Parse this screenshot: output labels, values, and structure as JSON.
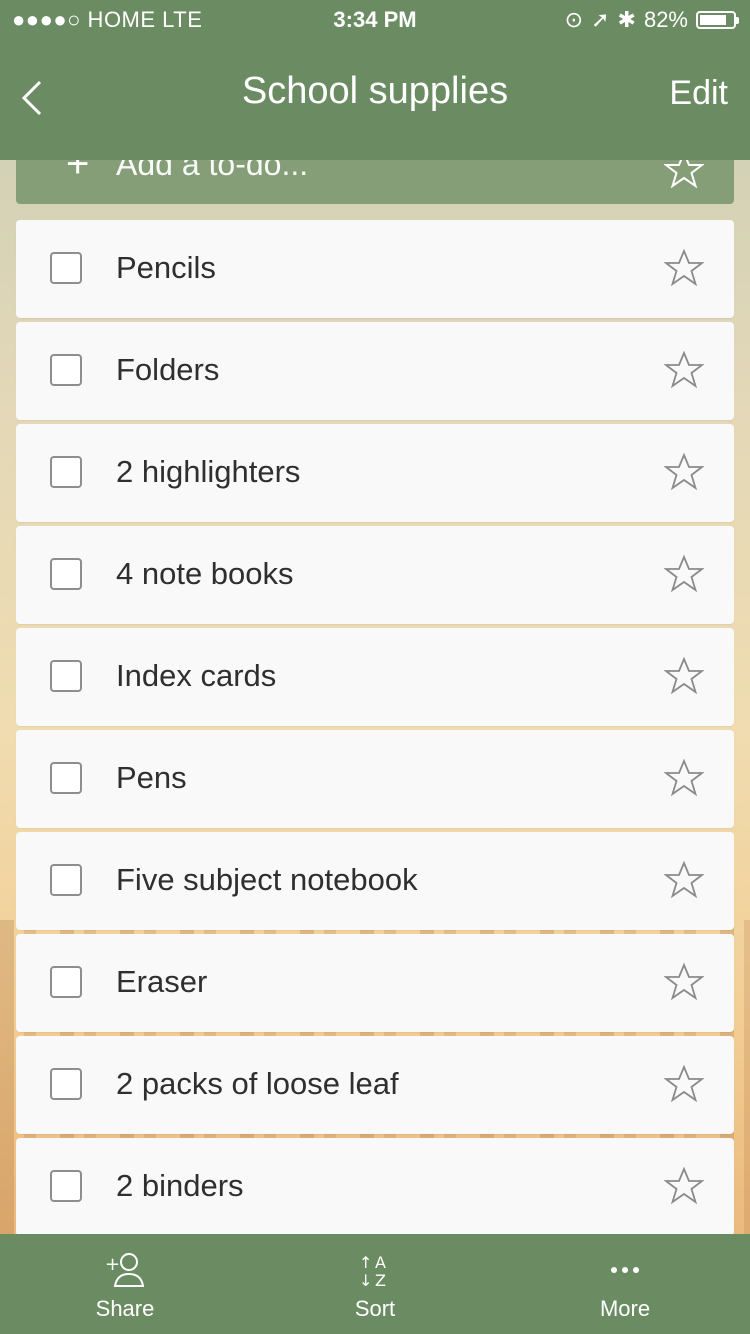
{
  "status_bar": {
    "carrier": "●●●●○ HOME  LTE",
    "time": "3:34 PM",
    "battery_text": "82%",
    "battery_level": 0.82
  },
  "nav": {
    "title": "School supplies",
    "edit_label": "Edit"
  },
  "add_todo": {
    "placeholder": "Add a to-do..."
  },
  "items": [
    {
      "label": "Pencils"
    },
    {
      "label": "Folders"
    },
    {
      "label": "2 highlighters"
    },
    {
      "label": "4 note books"
    },
    {
      "label": "Index cards"
    },
    {
      "label": "Pens"
    },
    {
      "label": "Five subject notebook"
    },
    {
      "label": "Eraser"
    },
    {
      "label": "2 packs of loose leaf"
    },
    {
      "label": "2 binders"
    }
  ],
  "tabbar": {
    "share_label": "Share",
    "sort_label": "Sort",
    "more_label": "More"
  },
  "colors": {
    "accent": "#6b8c63",
    "row_background": "#f9f9f9"
  }
}
